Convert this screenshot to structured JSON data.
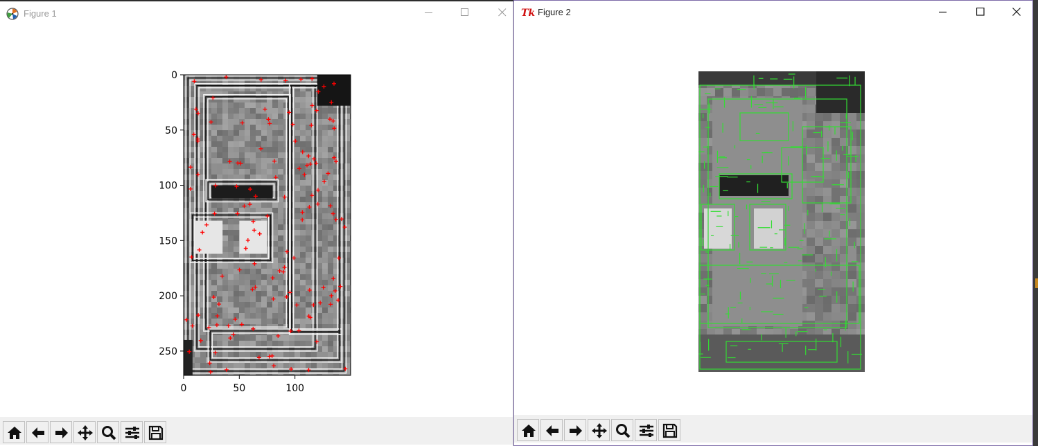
{
  "windows": [
    {
      "title": "Figure 1",
      "app_icon": "matplotlib-icon",
      "plot": {
        "x_ticks": [
          "0",
          "50",
          "100"
        ],
        "y_ticks": [
          "0",
          "50",
          "100",
          "150",
          "200",
          "250"
        ],
        "image_data_extent": {
          "x": [
            0,
            150
          ],
          "y": [
            0,
            272
          ]
        },
        "marker_color": "#ff0000",
        "marker_style": "+"
      }
    },
    {
      "title": "Figure 2",
      "app_icon": "tk-icon",
      "plot": {
        "axes_visible": false,
        "outline_color": "#33dd33"
      }
    }
  ],
  "caption_buttons": [
    "minimize-icon",
    "maximize-icon",
    "close-icon"
  ],
  "toolbar_buttons": [
    "home-icon",
    "back-arrow-icon",
    "forward-arrow-icon",
    "pan-icon",
    "zoom-icon",
    "configure-subplots-icon",
    "save-icon"
  ]
}
